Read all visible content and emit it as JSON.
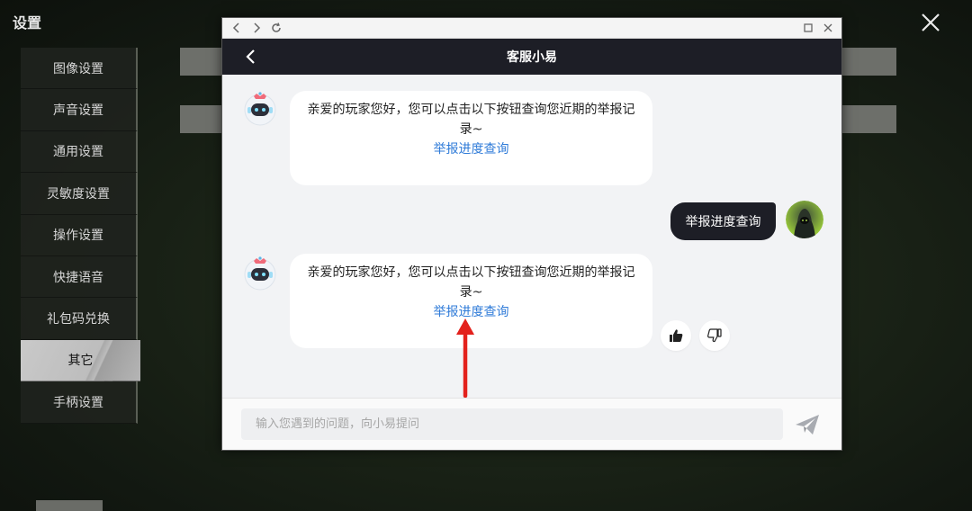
{
  "page": {
    "title": "设置"
  },
  "side_menu": {
    "items": [
      {
        "label": "图像设置",
        "active": false
      },
      {
        "label": "声音设置",
        "active": false
      },
      {
        "label": "通用设置",
        "active": false
      },
      {
        "label": "灵敏度设置",
        "active": false
      },
      {
        "label": "操作设置",
        "active": false
      },
      {
        "label": "快捷语音",
        "active": false
      },
      {
        "label": "礼包码兑换",
        "active": false
      },
      {
        "label": "其它",
        "active": true
      },
      {
        "label": "手柄设置",
        "active": false
      }
    ]
  },
  "chat": {
    "title": "客服小易",
    "messages": [
      {
        "from": "bot",
        "text": "亲爱的玩家您好，您可以点击以下按钮查询您近期的举报记录~",
        "link": "举报进度查询"
      },
      {
        "from": "user",
        "text": "举报进度查询"
      },
      {
        "from": "bot",
        "text": "亲爱的玩家您好，您可以点击以下按钮查询您近期的举报记录~",
        "link": "举报进度查询"
      }
    ],
    "feedback": {
      "like_icon": "thumbs-up-icon",
      "dislike_icon": "thumbs-down-icon"
    },
    "input": {
      "placeholder": "输入您遇到的问题，向小易提问",
      "value": ""
    }
  },
  "colors": {
    "header_bg": "#1d1e26",
    "link": "#2f7bd8",
    "arrow": "#e3211c",
    "chat_bg": "#f2f3f5"
  }
}
